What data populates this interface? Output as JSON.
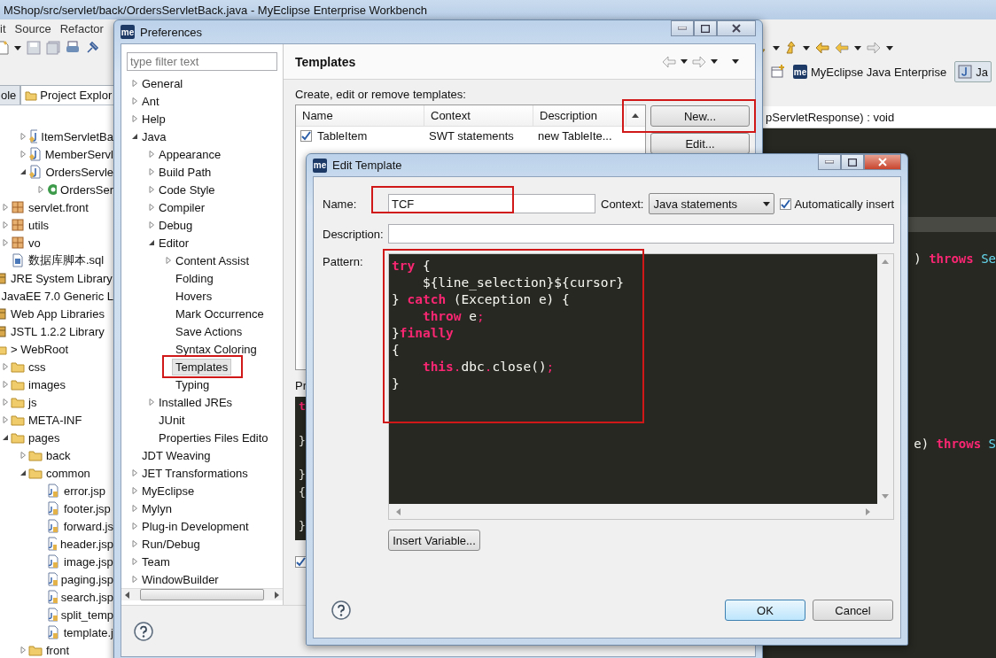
{
  "workbench": {
    "title": "MShop/src/servlet/back/OrdersServletBack.java - MyEclipse Enterprise Workbench",
    "menu": [
      "it",
      "Source",
      "Refactor"
    ],
    "perspectives": [
      {
        "logo": "me",
        "label": "MyEclipse Java Enterprise",
        "selected": false
      },
      {
        "label": "Ja",
        "selected": true
      }
    ],
    "view_tabs": [
      {
        "label": "ole",
        "selected": false
      },
      {
        "label": "Project Explor",
        "selected": true
      }
    ],
    "explorer": [
      {
        "kind": "java-file",
        "label": "ItemServletBa",
        "expanded": false
      },
      {
        "kind": "java-file",
        "label": "MemberServl",
        "expanded": false
      },
      {
        "kind": "java-file",
        "label": "OrdersServle",
        "expanded": true,
        "children": [
          {
            "kind": "class",
            "label": "OrdersSer",
            "expanded": false
          }
        ]
      },
      {
        "kind": "package",
        "label": "servlet.front",
        "expanded": false
      },
      {
        "kind": "package",
        "label": "utils",
        "expanded": false
      },
      {
        "kind": "package",
        "label": "vo",
        "expanded": false
      },
      {
        "kind": "sql-file",
        "label": "数据库脚本.sql"
      },
      {
        "kind": "library",
        "label": "JRE System Library"
      },
      {
        "kind": "library",
        "label": "JavaEE 7.0 Generic L"
      },
      {
        "kind": "library",
        "label": "Web App Libraries"
      },
      {
        "kind": "library",
        "label": "JSTL 1.2.2 Library"
      },
      {
        "kind": "web-root",
        "label": "> WebRoot",
        "children": [
          {
            "kind": "folder",
            "label": "css",
            "expanded": false
          },
          {
            "kind": "folder",
            "label": "images",
            "expanded": false
          },
          {
            "kind": "folder",
            "label": "js",
            "expanded": false
          },
          {
            "kind": "folder",
            "label": "META-INF",
            "expanded": false
          },
          {
            "kind": "folder",
            "label": "pages",
            "expanded": true,
            "children": [
              {
                "kind": "folder",
                "label": "back",
                "expanded": false
              },
              {
                "kind": "folder",
                "label": "common",
                "expanded": true,
                "children": [
                  {
                    "kind": "jsp-file",
                    "label": "error.jsp"
                  },
                  {
                    "kind": "jsp-file",
                    "label": "footer.jsp"
                  },
                  {
                    "kind": "jsp-file",
                    "label": "forward.js"
                  },
                  {
                    "kind": "jsp-file",
                    "label": "header.jsp"
                  },
                  {
                    "kind": "jsp-file",
                    "label": "image.jsp"
                  },
                  {
                    "kind": "jsp-file",
                    "label": "paging.jsp"
                  },
                  {
                    "kind": "jsp-file",
                    "label": "search.jsp"
                  },
                  {
                    "kind": "jsp-file",
                    "label": "split_temp"
                  },
                  {
                    "kind": "jsp-file",
                    "label": "template.j"
                  }
                ]
              },
              {
                "kind": "folder",
                "label": "front",
                "expanded": false
              }
            ]
          }
        ]
      }
    ],
    "editor": {
      "breadcrumb": "pServletResponse) : void",
      "code_lines": [
        {
          "text": ")",
          "keyword": "throws",
          "type": "Se"
        },
        {
          "text": "e)",
          "keyword": "throws",
          "type": "S"
        }
      ]
    }
  },
  "preferences": {
    "logo": "me",
    "title": "Preferences",
    "filter_placeholder": "type filter text",
    "tree": [
      {
        "label": "General",
        "expanded": false,
        "selected": false
      },
      {
        "label": "Ant",
        "expanded": false,
        "selected": false
      },
      {
        "label": "Help",
        "expanded": false,
        "selected": false
      },
      {
        "label": "Java",
        "expanded": true,
        "selected": false,
        "children": [
          {
            "label": "Appearance",
            "expanded": false,
            "selected": false
          },
          {
            "label": "Build Path",
            "expanded": false,
            "selected": false
          },
          {
            "label": "Code Style",
            "expanded": false,
            "selected": false
          },
          {
            "label": "Compiler",
            "expanded": false,
            "selected": false
          },
          {
            "label": "Debug",
            "expanded": false,
            "selected": false
          },
          {
            "label": "Editor",
            "expanded": true,
            "selected": false,
            "children": [
              {
                "label": "Content Assist",
                "expanded": false,
                "selected": false
              },
              {
                "label": "Folding",
                "selected": false
              },
              {
                "label": "Hovers",
                "selected": false
              },
              {
                "label": "Mark Occurrence",
                "selected": false
              },
              {
                "label": "Save Actions",
                "selected": false
              },
              {
                "label": "Syntax Coloring",
                "selected": false
              },
              {
                "label": "Templates",
                "selected": true,
                "highlighted": true
              },
              {
                "label": "Typing",
                "selected": false
              }
            ]
          },
          {
            "label": "Installed JREs",
            "expanded": false,
            "selected": false
          },
          {
            "label": "JUnit",
            "selected": false
          },
          {
            "label": "Properties Files Edito",
            "selected": false
          }
        ]
      },
      {
        "label": "JDT Weaving",
        "selected": false
      },
      {
        "label": "JET Transformations",
        "expanded": false,
        "selected": false
      },
      {
        "label": "MyEclipse",
        "expanded": false,
        "selected": false
      },
      {
        "label": "Mylyn",
        "expanded": false,
        "selected": false
      },
      {
        "label": "Plug-in Development",
        "expanded": false,
        "selected": false
      },
      {
        "label": "Run/Debug",
        "expanded": false,
        "selected": false
      },
      {
        "label": "Team",
        "expanded": false,
        "selected": false
      },
      {
        "label": "WindowBuilder",
        "expanded": false,
        "selected": false
      }
    ],
    "page_title": "Templates",
    "intro": "Create, edit or remove templates:",
    "columns": [
      "Name",
      "Context",
      "Description"
    ],
    "rows": [
      {
        "checked": true,
        "name": "TableItem",
        "context": "SWT statements",
        "description": "new TableIte..."
      }
    ],
    "buttons": [
      {
        "label": "New...",
        "highlighted": true
      },
      {
        "label": "Edit...",
        "highlighted": false
      }
    ],
    "preview_label": "Pr",
    "preview_lines": [
      {
        "kind": "keyword",
        "text": "t"
      },
      {
        "kind": "blank"
      },
      {
        "kind": "plain",
        "text": "}"
      },
      {
        "kind": "blank"
      },
      {
        "kind": "plain",
        "text": "}"
      },
      {
        "kind": "plain",
        "text": "{"
      },
      {
        "kind": "blank"
      },
      {
        "kind": "plain",
        "text": "}"
      }
    ],
    "formatter_checked": true
  },
  "edit_template": {
    "logo": "me",
    "title": "Edit Template",
    "name_label": "Name:",
    "name_value": "TCF",
    "name_highlighted": true,
    "context_label": "Context:",
    "context_value": "Java statements",
    "auto_insert": {
      "label": "Automatically insert",
      "checked": true
    },
    "description_label": "Description:",
    "pattern_label": "Pattern:",
    "pattern_highlighted": true,
    "pattern": [
      {
        "indented": false,
        "tokens": [
          {
            "kind": "keyword",
            "text": "try"
          },
          {
            "kind": "plain",
            "text": " {"
          }
        ]
      },
      {
        "indented": true,
        "tokens": [
          {
            "kind": "plain",
            "text": "${line_selection}${cursor}"
          }
        ]
      },
      {
        "indented": false,
        "tokens": [
          {
            "kind": "plain",
            "text": "} "
          },
          {
            "kind": "keyword",
            "text": "catch"
          },
          {
            "kind": "plain",
            "text": " (Exception e) {"
          }
        ]
      },
      {
        "indented": true,
        "tokens": [
          {
            "kind": "keyword",
            "text": "throw"
          },
          {
            "kind": "plain",
            "text": " e"
          },
          {
            "kind": "operator",
            "text": ";"
          }
        ]
      },
      {
        "indented": false,
        "tokens": [
          {
            "kind": "plain",
            "text": "}"
          },
          {
            "kind": "keyword",
            "text": "finally"
          }
        ]
      },
      {
        "indented": false,
        "tokens": [
          {
            "kind": "plain",
            "text": "{"
          }
        ]
      },
      {
        "indented": true,
        "tokens": [
          {
            "kind": "keyword",
            "text": "this"
          },
          {
            "kind": "operator",
            "text": "."
          },
          {
            "kind": "plain",
            "text": "dbc"
          },
          {
            "kind": "operator",
            "text": "."
          },
          {
            "kind": "plain",
            "text": "close()"
          },
          {
            "kind": "operator",
            "text": ";"
          }
        ]
      },
      {
        "indented": false,
        "tokens": [
          {
            "kind": "plain",
            "text": "}"
          }
        ]
      }
    ],
    "insert_button": "Insert Variable...",
    "ok": "OK",
    "cancel": "Cancel"
  }
}
